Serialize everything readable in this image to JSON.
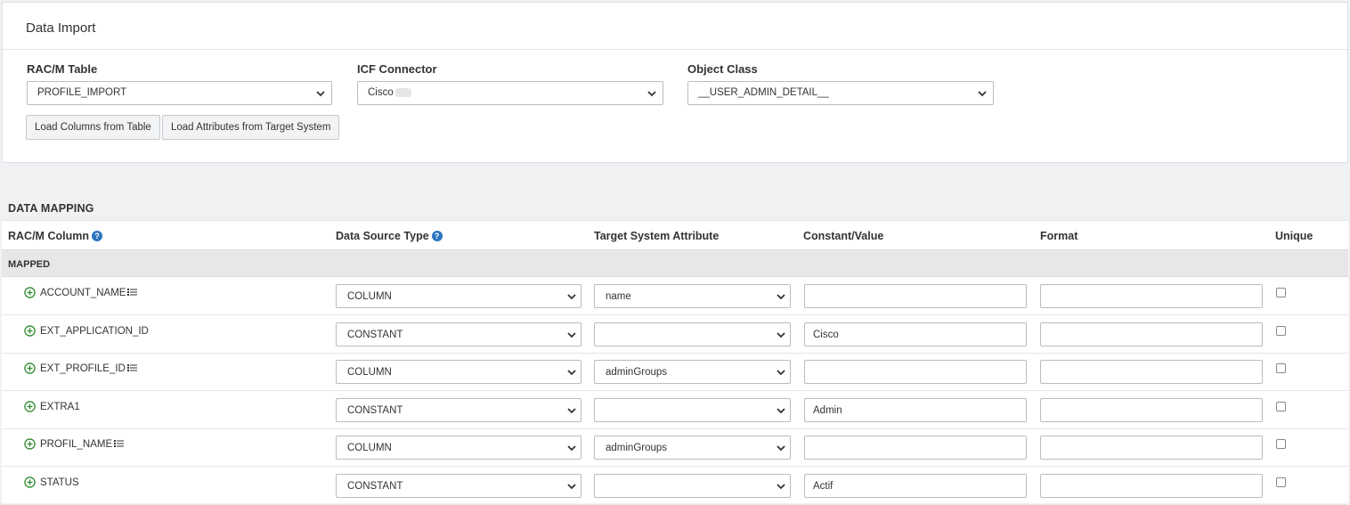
{
  "data_import": {
    "title": "Data Import",
    "racm_table": {
      "label": "RAC/M Table",
      "value": "PROFILE_IMPORT"
    },
    "icf_connector": {
      "label": "ICF Connector",
      "value": "Cisco"
    },
    "object_class": {
      "label": "Object Class",
      "value": "__USER_ADMIN_DETAIL__"
    },
    "buttons": {
      "load_columns": "Load Columns from Table",
      "load_attributes": "Load Attributes from Target System"
    }
  },
  "data_mapping": {
    "title": "DATA MAPPING",
    "headers": {
      "racm_column": "RAC/M Column",
      "data_source_type": "Data Source Type",
      "target_system_attribute": "Target System Attribute",
      "constant_value": "Constant/Value",
      "format": "Format",
      "unique": "Unique"
    },
    "group_label": "MAPPED",
    "rows": [
      {
        "column": "ACCOUNT_NAME",
        "list_icon": true,
        "source_type": "COLUMN",
        "target_attr": "name",
        "constant": "",
        "format": "",
        "unique": false
      },
      {
        "column": "EXT_APPLICATION_ID",
        "list_icon": false,
        "source_type": "CONSTANT",
        "target_attr": "",
        "constant": "Cisco",
        "format": "",
        "unique": false
      },
      {
        "column": "EXT_PROFILE_ID",
        "list_icon": true,
        "source_type": "COLUMN",
        "target_attr": "adminGroups",
        "constant": "",
        "format": "",
        "unique": false
      },
      {
        "column": "EXTRA1",
        "list_icon": false,
        "source_type": "CONSTANT",
        "target_attr": "",
        "constant": "Admin",
        "format": "",
        "unique": false
      },
      {
        "column": "PROFIL_NAME",
        "list_icon": true,
        "source_type": "COLUMN",
        "target_attr": "adminGroups",
        "constant": "",
        "format": "",
        "unique": false
      },
      {
        "column": "STATUS",
        "list_icon": false,
        "source_type": "CONSTANT",
        "target_attr": "",
        "constant": "Actif",
        "format": "",
        "unique": false
      }
    ]
  },
  "colors": {
    "accent_green": "#2e8b2e",
    "help_blue": "#2e74c0",
    "group_row_bg": "#e7e7e7",
    "page_bg": "#eff1f3"
  },
  "icons": {
    "add": "plus-circle-icon",
    "list": "list-icon",
    "help": "help-icon",
    "dropdown": "chevron-down-icon"
  }
}
